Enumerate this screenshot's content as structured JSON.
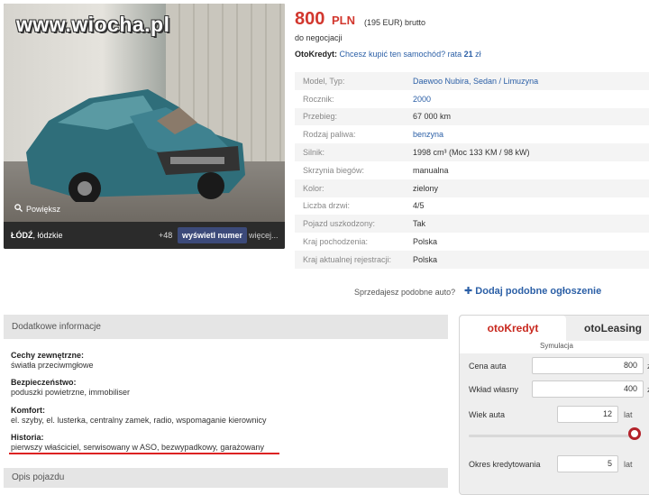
{
  "watermark": "www.wiocha.pl",
  "photo": {
    "zoom_label": "Powiększ",
    "city": "ŁÓDŹ",
    "region": ", łódzkie",
    "phone_prefix": "+48",
    "show_number": "wyświetl numer",
    "more": "więcej..."
  },
  "price": {
    "amount": "800",
    "currency": "PLN",
    "eur": "(195 EUR) brutto",
    "negotiable": "do negocjacji"
  },
  "otokredyt": {
    "label": "OtoKredyt:",
    "question": "Chcesz kupić ten samochód? rata",
    "rate": "21",
    "unit": "zł"
  },
  "params": [
    {
      "label": "Model, Typ:",
      "value": "Daewoo Nubira, Sedan / Limuzyna",
      "link": true
    },
    {
      "label": "Rocznik:",
      "value": "2000",
      "link": true
    },
    {
      "label": "Przebieg:",
      "value": "67 000 km",
      "link": false
    },
    {
      "label": "Rodzaj paliwa:",
      "value": "benzyna",
      "link": true
    },
    {
      "label": "Silnik:",
      "value": "1998 cm³ (Moc 133 KM / 98 kW)",
      "link": false
    },
    {
      "label": "Skrzynia biegów:",
      "value": "manualna",
      "link": false
    },
    {
      "label": "Kolor:",
      "value": "zielony",
      "link": false
    },
    {
      "label": "Liczba drzwi:",
      "value": "4/5",
      "link": false
    },
    {
      "label": "Pojazd uszkodzony:",
      "value": "Tak",
      "link": false
    },
    {
      "label": "Kraj pochodzenia:",
      "value": "Polska",
      "link": false
    },
    {
      "label": "Kraj aktualnej rejestracji:",
      "value": "Polska",
      "link": false
    }
  ],
  "sell": {
    "text": "Sprzedajesz podobne auto?",
    "add": "Dodaj podobne ogłoszenie"
  },
  "extra": {
    "heading": "Dodatkowe informacje",
    "features": [
      {
        "title": "Cechy zewnętrzne:",
        "value": "światła przeciwmgłowe"
      },
      {
        "title": "Bezpieczeństwo:",
        "value": "poduszki powietrzne, immobiliser"
      },
      {
        "title": "Komfort:",
        "value": "el. szyby, el. lusterka, centralny zamek, radio, wspomaganie kierownicy"
      },
      {
        "title": "Historia:",
        "value": "pierwszy właściciel, serwisowany w ASO, bezwypadkowy, garażowany"
      }
    ]
  },
  "opis": {
    "heading": "Opis pojazdu"
  },
  "calc": {
    "tab_kredyt": "otoKredyt",
    "tab_leasing": "otoLeasing",
    "simulation": "Symulacja",
    "price_label": "Cena auta",
    "price_value": "800",
    "price_unit": "z",
    "own_label": "Wkład własny",
    "own_value": "400",
    "own_unit": "z",
    "age_label": "Wiek auta",
    "age_value": "12",
    "age_unit": "lat",
    "term_label": "Okres kredytowania",
    "term_value": "5",
    "term_unit": "lat",
    "age_slider_fraction": 0.97
  },
  "colors": {
    "price": "#d2372e",
    "link": "#2b5fa6",
    "accent": "#b3222a"
  }
}
